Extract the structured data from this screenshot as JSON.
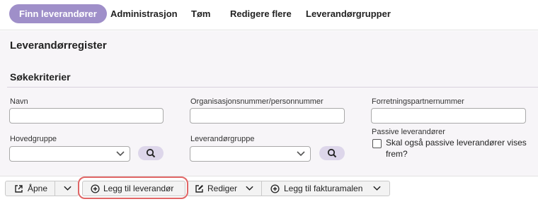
{
  "tabs": [
    {
      "label": "Finn leverandører",
      "active": true
    },
    {
      "label": "Administrasjon"
    },
    {
      "label": "Tøm"
    },
    {
      "label": "Redigere flere"
    },
    {
      "label": "Leverandørgrupper"
    }
  ],
  "page_title": "Leverandørregister",
  "section_title": "Søkekriterier",
  "fields": {
    "navn": {
      "label": "Navn",
      "value": ""
    },
    "orgnr": {
      "label": "Organisasjonsnummer/personnummer",
      "value": ""
    },
    "forretningspartner": {
      "label": "Forretningspartnernummer",
      "value": ""
    },
    "hovedgruppe": {
      "label": "Hovedgruppe",
      "value": ""
    },
    "leverandorgruppe": {
      "label": "Leverandørgruppe",
      "value": ""
    },
    "passive": {
      "label": "Passive leverandører",
      "checkbox_label": "Skal også passive leverandører vises frem?",
      "checked": false
    }
  },
  "toolbar": {
    "open": "Åpne",
    "add_supplier": "Legg til leverandør",
    "edit": "Rediger",
    "add_invoice_template": "Legg til fakturamalen"
  },
  "colors": {
    "accent": "#9f8fc9",
    "search_button": "#ddd6ea",
    "highlight": "#e06666"
  }
}
